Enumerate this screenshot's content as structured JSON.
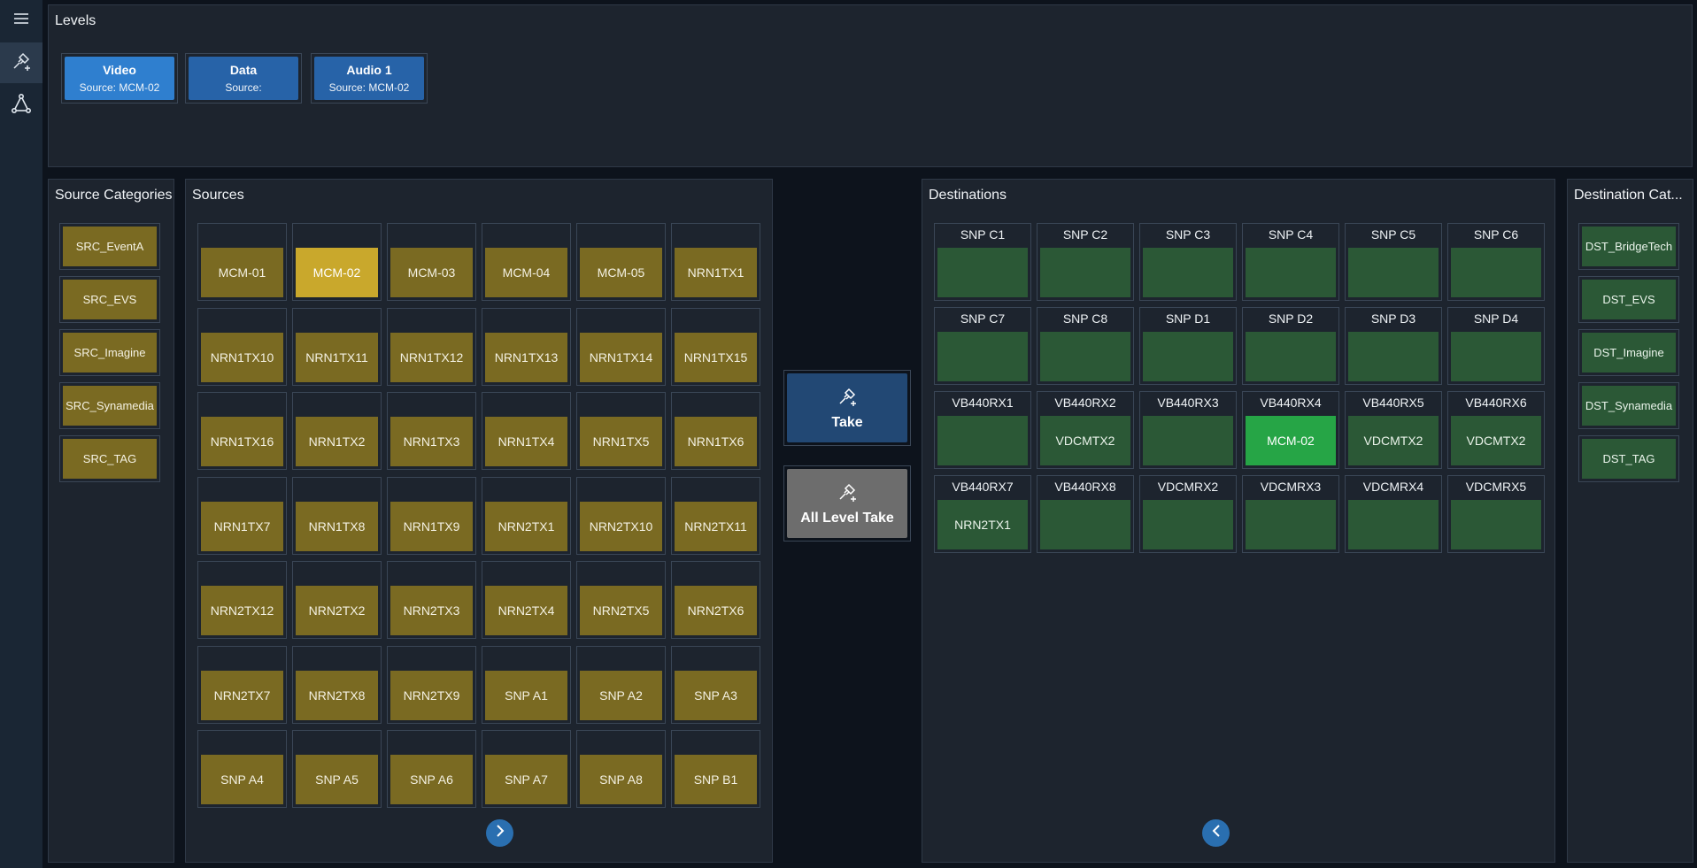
{
  "rail": {
    "icons": [
      "menu-icon",
      "route-icon",
      "topology-icon"
    ]
  },
  "levels": {
    "title": "Levels",
    "items": [
      {
        "name": "Video",
        "source": "Source: MCM-02",
        "color": "#2f7fcf"
      },
      {
        "name": "Data",
        "source": "Source:",
        "color": "#2763a8"
      },
      {
        "name": "Audio 1",
        "source": "Source: MCM-02",
        "color": "#2763a8"
      }
    ]
  },
  "source_categories": {
    "title": "Source Categories",
    "items": [
      "SRC_EventA",
      "SRC_EVS",
      "SRC_Imagine",
      "SRC_Synamedia",
      "SRC_TAG"
    ]
  },
  "sources": {
    "title": "Sources",
    "selected": "MCM-02",
    "items": [
      "MCM-01",
      "MCM-02",
      "MCM-03",
      "MCM-04",
      "MCM-05",
      "NRN1TX1",
      "NRN1TX10",
      "NRN1TX11",
      "NRN1TX12",
      "NRN1TX13",
      "NRN1TX14",
      "NRN1TX15",
      "NRN1TX16",
      "NRN1TX2",
      "NRN1TX3",
      "NRN1TX4",
      "NRN1TX5",
      "NRN1TX6",
      "NRN1TX7",
      "NRN1TX8",
      "NRN1TX9",
      "NRN2TX1",
      "NRN2TX10",
      "NRN2TX11",
      "NRN2TX12",
      "NRN2TX2",
      "NRN2TX3",
      "NRN2TX4",
      "NRN2TX5",
      "NRN2TX6",
      "NRN2TX7",
      "NRN2TX8",
      "NRN2TX9",
      "SNP A1",
      "SNP A2",
      "SNP A3",
      "SNP A4",
      "SNP A5",
      "SNP A6",
      "SNP A7",
      "SNP A8",
      "SNP B1"
    ]
  },
  "actions": {
    "take_label": "Take",
    "all_level_take_label": "All Level Take"
  },
  "destinations": {
    "title": "Destinations",
    "selected": "VB440RX4",
    "items": [
      {
        "name": "SNP C1",
        "value": ""
      },
      {
        "name": "SNP C2",
        "value": ""
      },
      {
        "name": "SNP C3",
        "value": ""
      },
      {
        "name": "SNP C4",
        "value": ""
      },
      {
        "name": "SNP C5",
        "value": ""
      },
      {
        "name": "SNP C6",
        "value": ""
      },
      {
        "name": "SNP C7",
        "value": ""
      },
      {
        "name": "SNP C8",
        "value": ""
      },
      {
        "name": "SNP D1",
        "value": ""
      },
      {
        "name": "SNP D2",
        "value": ""
      },
      {
        "name": "SNP D3",
        "value": ""
      },
      {
        "name": "SNP D4",
        "value": ""
      },
      {
        "name": "VB440RX1",
        "value": ""
      },
      {
        "name": "VB440RX2",
        "value": "VDCMTX2"
      },
      {
        "name": "VB440RX3",
        "value": ""
      },
      {
        "name": "VB440RX4",
        "value": "MCM-02"
      },
      {
        "name": "VB440RX5",
        "value": "VDCMTX2"
      },
      {
        "name": "VB440RX6",
        "value": "VDCMTX2"
      },
      {
        "name": "VB440RX7",
        "value": "NRN2TX1"
      },
      {
        "name": "VB440RX8",
        "value": ""
      },
      {
        "name": "VDCMRX2",
        "value": ""
      },
      {
        "name": "VDCMRX3",
        "value": ""
      },
      {
        "name": "VDCMRX4",
        "value": ""
      },
      {
        "name": "VDCMRX5",
        "value": ""
      }
    ]
  },
  "destination_categories": {
    "title": "Destination Cat...",
    "items": [
      "DST_BridgeTech",
      "DST_EVS",
      "DST_Imagine",
      "DST_Synamedia",
      "DST_TAG"
    ]
  }
}
